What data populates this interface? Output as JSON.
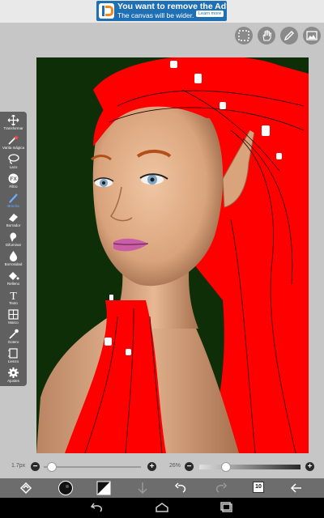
{
  "ad": {
    "title": "You want to remove the Ad?",
    "subtitle": "The canvas will be wider.",
    "learn_more": "Learn more"
  },
  "top_toolbar": {
    "icons": [
      "selection-icon",
      "hand-icon",
      "pencil-icon",
      "image-icon"
    ]
  },
  "tools": [
    {
      "key": "transform",
      "label": "Transformar",
      "icon": "move-icon"
    },
    {
      "key": "magic",
      "label": "Varita mágica",
      "icon": "magic-wand-icon"
    },
    {
      "key": "lasso",
      "label": "Lazo",
      "icon": "lasso-icon"
    },
    {
      "key": "filter",
      "label": "Filtro",
      "icon": "fx-icon"
    },
    {
      "key": "brush",
      "label": "Brocha",
      "icon": "brush-icon",
      "active": true
    },
    {
      "key": "eraser",
      "label": "Borrador",
      "icon": "eraser-icon"
    },
    {
      "key": "smudge",
      "label": "Difuminar",
      "icon": "smudge-icon"
    },
    {
      "key": "blur",
      "label": "Borrosidad",
      "icon": "drop-icon"
    },
    {
      "key": "fill",
      "label": "Relleno",
      "icon": "bucket-icon"
    },
    {
      "key": "text",
      "label": "Texto",
      "icon": "text-icon"
    },
    {
      "key": "frame",
      "label": "Marco",
      "icon": "frame-icon"
    },
    {
      "key": "eyedrop",
      "label": "Gotero",
      "icon": "eyedropper-icon"
    },
    {
      "key": "canvas",
      "label": "Lienzo",
      "icon": "canvas-icon"
    },
    {
      "key": "settings",
      "label": "Ajustes",
      "icon": "gear-icon"
    }
  ],
  "sliders": {
    "brush_size": "1.7px",
    "brush_size_level": 0.04,
    "opacity": "26%",
    "opacity_level": 0.26
  },
  "action_bar": {
    "layer_count": "10",
    "color_primary": "#111111",
    "color_secondary": "#ffffff"
  },
  "colors": {
    "canvas_bg": "#0e2e08",
    "hair": "#ff0000",
    "skin": "#d9a37c",
    "accent_blue": "#6ab0ff"
  }
}
